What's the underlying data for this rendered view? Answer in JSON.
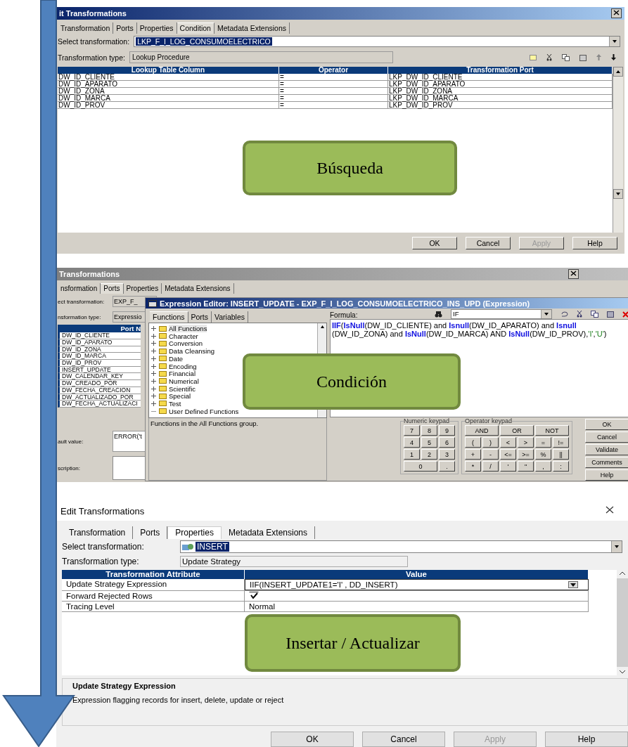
{
  "lookup_dialog": {
    "title": "it Transformations",
    "tabs": [
      {
        "label": "Transformation",
        "selected": false
      },
      {
        "label": "Ports",
        "selected": false
      },
      {
        "label": "Properties",
        "selected": false
      },
      {
        "label": "Condition",
        "selected": true
      },
      {
        "label": "Metadata Extensions",
        "selected": false
      }
    ],
    "select_label": "Select transformation:",
    "select_value": "LKP_F_I_LOG_CONSUMOELECTRICO",
    "type_label": "Transformation type:",
    "type_value": "Lookup Procedure",
    "columns": [
      "Lookup Table Column",
      "Operator",
      "Transformation Port"
    ],
    "rows": [
      [
        "DW_ID_CLIENTE",
        "=",
        "LKP_DW_ID_CLIENTE"
      ],
      [
        "DW_ID_APARATO",
        "=",
        "LKP_DW_ID_APARATO"
      ],
      [
        "DW_ID_ZONA",
        "=",
        "LKP_DW_ID_ZONA"
      ],
      [
        "DW_ID_MARCA",
        "=",
        "LKP_DW_ID_MARCA"
      ],
      [
        "DW_ID_PROV",
        "=",
        "LKP_DW_ID_PROV"
      ]
    ],
    "buttons": [
      {
        "label": "OK",
        "disabled": false
      },
      {
        "label": "Cancel",
        "disabled": false
      },
      {
        "label": "Apply",
        "disabled": true
      },
      {
        "label": "Help",
        "disabled": false
      }
    ],
    "callout": "Búsqueda"
  },
  "expression_dialog": {
    "title": "Transformations",
    "tabs": [
      {
        "label": "nsformation",
        "selected": false
      },
      {
        "label": "Ports",
        "selected": true
      },
      {
        "label": "Properties",
        "selected": false
      },
      {
        "label": "Metadata Extensions",
        "selected": false
      }
    ],
    "select_label": "ect transformation:",
    "select_value": "EXP_F_",
    "type_label": "nsformation type:",
    "type_value": "Expressio",
    "port_header": "Port N",
    "ports": [
      "DW_ID_CLIENTE",
      "DW_ID_APARATO",
      "DW_ID_ZONA",
      "DW_ID_MARCA",
      "DW_ID_PROV",
      "INSERT_UPDATE",
      "DW_CALENDAR_KEY",
      "DW_CREADO_POR",
      "DW_FECHA_CREACION",
      "DW_ACTUALIZADO_POR",
      "DW_FECHA_ACTUALIZACI"
    ],
    "default_label": "ault value:",
    "default_value": "ERROR('t",
    "description_label": "scription:",
    "editor": {
      "title": "Expression Editor: INSERT_UPDATE - EXP_F_I_LOG_CONSUMOELECTRICO_INS_UPD (Expression)",
      "tabs": [
        {
          "label": "Functions",
          "selected": true
        },
        {
          "label": "Ports",
          "selected": false
        },
        {
          "label": "Variables",
          "selected": false
        }
      ],
      "tree": [
        {
          "label": "All Functions",
          "selected": true,
          "expandable": true
        },
        {
          "label": "Character",
          "selected": false,
          "expandable": true
        },
        {
          "label": "Conversion",
          "selected": false,
          "expandable": true
        },
        {
          "label": "Data Cleansing",
          "selected": false,
          "expandable": true
        },
        {
          "label": "Date",
          "selected": false,
          "expandable": true
        },
        {
          "label": "Encoding",
          "selected": false,
          "expandable": true
        },
        {
          "label": "Financial",
          "selected": false,
          "expandable": true
        },
        {
          "label": "Numerical",
          "selected": false,
          "expandable": true
        },
        {
          "label": "Scientific",
          "selected": false,
          "expandable": true
        },
        {
          "label": "Special",
          "selected": false,
          "expandable": true
        },
        {
          "label": "Test",
          "selected": false,
          "expandable": true
        },
        {
          "label": "User Defined Functions",
          "selected": false,
          "expandable": false
        }
      ],
      "tree_description": "Functions in the All Functions group.",
      "formula_label": "Formula:",
      "search_value": "IF",
      "formula": [
        {
          "text": "IIF",
          "kind": "function"
        },
        {
          "text": "(",
          "kind": "plain"
        },
        {
          "text": "IsNull",
          "kind": "function"
        },
        {
          "text": "(DW_ID_CLIENTE) and ",
          "kind": "plain"
        },
        {
          "text": "Isnull",
          "kind": "function"
        },
        {
          "text": "(DW_ID_APARATO) and ",
          "kind": "plain"
        },
        {
          "text": "Isnull",
          "kind": "function"
        },
        {
          "text": " (DW_ID_ZONA) and ",
          "kind": "plain"
        },
        {
          "text": "IsNull",
          "kind": "function"
        },
        {
          "text": "(DW_ID_MARCA) AND ",
          "kind": "plain"
        },
        {
          "text": "IsNull",
          "kind": "function"
        },
        {
          "text": "(DW_ID_PROV),",
          "kind": "plain"
        },
        {
          "text": "'I'",
          "kind": "string"
        },
        {
          "text": ",",
          "kind": "plain"
        },
        {
          "text": "'U'",
          "kind": "string"
        },
        {
          "text": ")",
          "kind": "plain"
        }
      ],
      "numeric_label": "Numeric keypad",
      "numeric_keys": [
        {
          "label": "7",
          "wide": false
        },
        {
          "label": "8",
          "wide": false
        },
        {
          "label": "9",
          "wide": false
        },
        {
          "label": "4",
          "wide": false
        },
        {
          "label": "5",
          "wide": false
        },
        {
          "label": "6",
          "wide": false
        },
        {
          "label": "1",
          "wide": false
        },
        {
          "label": "2",
          "wide": false
        },
        {
          "label": "3",
          "wide": false
        },
        {
          "label": "0",
          "wide": true
        },
        {
          "label": ".",
          "wide": false
        }
      ],
      "operator_label": "Operator keypad",
      "operator_keys": [
        {
          "label": "AND",
          "wide": true
        },
        {
          "label": "OR",
          "wide": true
        },
        {
          "label": "NOT",
          "wide": true
        },
        {
          "label": "(",
          "wide": false
        },
        {
          "label": ")",
          "wide": false
        },
        {
          "label": "<",
          "wide": false
        },
        {
          "label": ">",
          "wide": false
        },
        {
          "label": "=",
          "wide": false
        },
        {
          "label": "!=",
          "wide": false
        },
        {
          "label": "+",
          "wide": false
        },
        {
          "label": "-",
          "wide": false
        },
        {
          "label": "<=",
          "wide": false
        },
        {
          "label": ">=",
          "wide": false
        },
        {
          "label": "%",
          "wide": false
        },
        {
          "label": "||",
          "wide": false
        },
        {
          "label": "*",
          "wide": false
        },
        {
          "label": "/",
          "wide": false
        },
        {
          "label": "'",
          "wide": false
        },
        {
          "label": "\"",
          "wide": false
        },
        {
          "label": ",",
          "wide": false
        },
        {
          "label": ":",
          "wide": false
        }
      ],
      "buttons": [
        "OK",
        "Cancel",
        "Validate",
        "Comments",
        "Help"
      ]
    },
    "callout": "Condición"
  },
  "update_dialog": {
    "title": "Edit Transformations",
    "tabs": [
      {
        "label": "Transformation",
        "selected": false
      },
      {
        "label": "Ports",
        "selected": false
      },
      {
        "label": "Properties",
        "selected": true
      },
      {
        "label": "Metadata Extensions",
        "selected": false
      }
    ],
    "select_label": "Select transformation:",
    "select_value": "INSERT",
    "type_label": "Transformation type:",
    "type_value": "Update Strategy",
    "columns": [
      "Transformation Attribute",
      "Value"
    ],
    "rows": [
      {
        "attribute": "Update Strategy Expression",
        "kind": "expression",
        "value": "IIF(INSERT_UPDATE1='I' , DD_INSERT)"
      },
      {
        "attribute": "Forward Rejected Rows",
        "kind": "checkbox",
        "checked": true
      },
      {
        "attribute": "Tracing Level",
        "kind": "text",
        "value": "Normal"
      }
    ],
    "description_title": "Update Strategy Expression",
    "description_text": "Expression flagging records for insert, delete, update or reject",
    "buttons": [
      {
        "label": "OK",
        "disabled": false
      },
      {
        "label": "Cancel",
        "disabled": false
      },
      {
        "label": "Apply",
        "disabled": true
      },
      {
        "label": "Help",
        "disabled": false
      }
    ],
    "callout": "Insertar / Actualizar"
  }
}
